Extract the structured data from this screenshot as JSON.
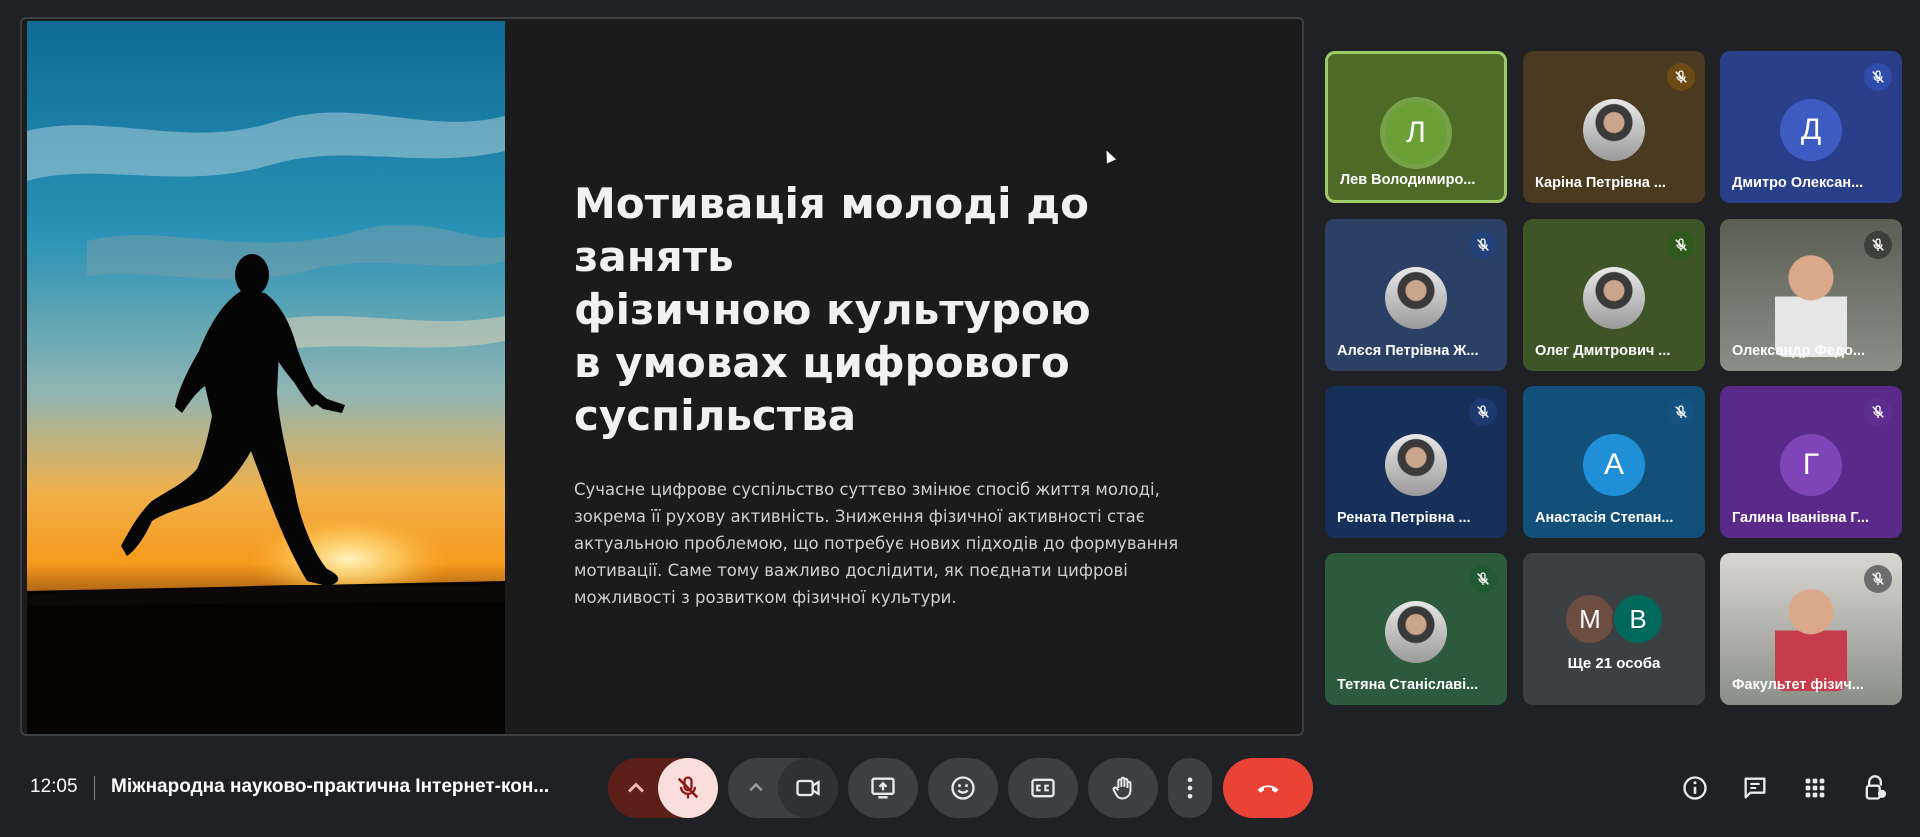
{
  "slide": {
    "title": "Мотивація молоді до занять\nфізичною культурою\nв умовах цифрового\nсуспільства",
    "body": "Сучасне цифрове суспільство суттєво змінює спосіб життя молоді, зокрема її рухову активність. Зниження фізичної активності стає актуальною проблемою, що потребує нових підходів до формування мотивації. Саме тому важливо дослідити, як поєднати цифрові можливості з розвитком фізичної культури."
  },
  "participants": [
    {
      "name": "Лев Володимиро...",
      "initial": "Л",
      "muted": false,
      "speaking": true,
      "tile_color": "#4d6b26",
      "avatar_color": "#6aa036"
    },
    {
      "name": "Каріна Петрівна ...",
      "initial": "",
      "muted": true,
      "tile_color": "#4a3a20",
      "mute_color": "#6b4a14",
      "avatar": "photo"
    },
    {
      "name": "Дмитро Олексан...",
      "initial": "Д",
      "muted": true,
      "tile_color": "#2a3f8a",
      "avatar_color": "#3e5bc4",
      "mute_color": "#2f4cab"
    },
    {
      "name": "Алєся Петрівна Ж...",
      "initial": "",
      "muted": true,
      "tile_color": "#2c4066",
      "mute_color": "#24427a",
      "avatar": "photo"
    },
    {
      "name": "Олег Дмитрович ...",
      "initial": "",
      "muted": true,
      "tile_color": "#3d5527",
      "mute_color": "#2f5a1c",
      "avatar": "photo"
    },
    {
      "name": "Олександр Федо...",
      "initial": "",
      "muted": true,
      "tile_color": "#5b5e52",
      "mute_color": "#3d4038",
      "avatar": "video"
    },
    {
      "name": "Рената Петрівна ...",
      "initial": "",
      "muted": true,
      "tile_color": "#17305a",
      "mute_color": "#1d3a70",
      "avatar": "photo"
    },
    {
      "name": "Анастасія Степан...",
      "initial": "А",
      "muted": true,
      "tile_color": "#12507a",
      "avatar_color": "#1f8fd8",
      "mute_color": "#15527f"
    },
    {
      "name": "Галина Іванівна Г...",
      "initial": "Г",
      "muted": true,
      "tile_color": "#5a2a8a",
      "avatar_color": "#7f45b8",
      "mute_color": "#5d2e8f"
    },
    {
      "name": "Тетяна Станіславі...",
      "initial": "",
      "muted": true,
      "tile_color": "#2d5a3a",
      "mute_color": "#1f5a33",
      "avatar": "photo"
    },
    {
      "name": "Факультет фізич...",
      "initial": "",
      "muted": true,
      "tile_color": "#d9d6d2",
      "mute_color": "#6d6d6d",
      "avatar": "video"
    }
  ],
  "more": {
    "label": "Ще 21 особа",
    "initials": [
      "М",
      "В"
    ],
    "colors": [
      "#6d4c41",
      "#00695c"
    ]
  },
  "bottom": {
    "time": "12:05",
    "meeting_title": "Міжнародна науково-практична Інтернет-кон..."
  },
  "colors": {
    "end_call": "#ea4335",
    "mic_off_bg": "#f9dedc",
    "mic_group": "#5c1f1a"
  }
}
